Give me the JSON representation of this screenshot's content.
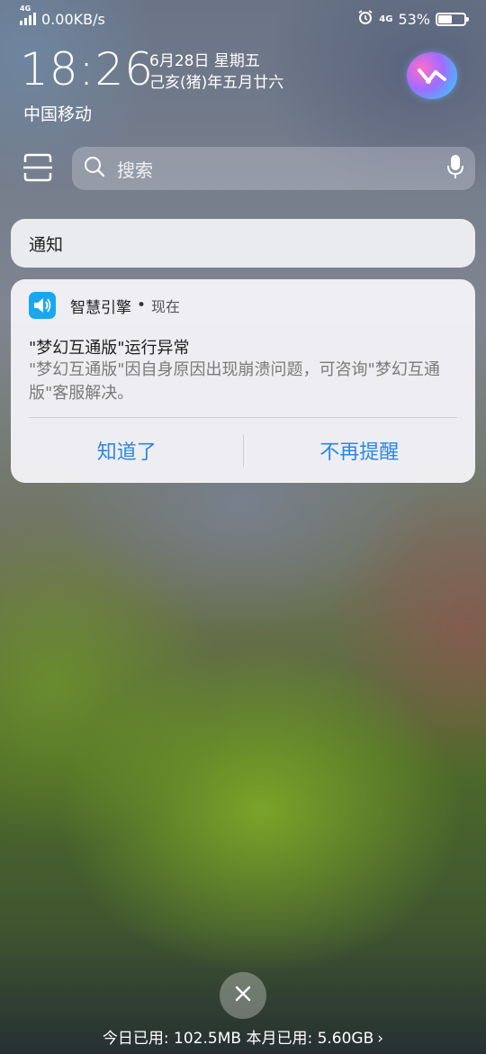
{
  "status_bar": {
    "network_type": "4G",
    "network_speed": "0.00KB/s",
    "secondary_network": "4G",
    "battery_percent": "53%",
    "battery_level": 0.53
  },
  "lockscreen": {
    "time": "18:26",
    "date": "6月28日 星期五",
    "lunar_date": "己亥(猪)年五月廿六",
    "carrier": "中国移动"
  },
  "search": {
    "placeholder": "搜索"
  },
  "notifications": {
    "header": "通知",
    "items": [
      {
        "app_name": "智慧引擎",
        "time": "现在",
        "title": "\"梦幻互通版\"运行异常",
        "body": "\"梦幻互通版\"因自身原因出现崩溃问题，可咨询\"梦幻互通版\"客服解决。",
        "actions": [
          "知道了",
          "不再提醒"
        ]
      }
    ]
  },
  "footer": {
    "data_usage": "今日已用: 102.5MB 本月已用: 5.60GB",
    "chevron": "›"
  },
  "colors": {
    "accent": "#2c86e0",
    "app_icon": "#1aa7f0"
  }
}
